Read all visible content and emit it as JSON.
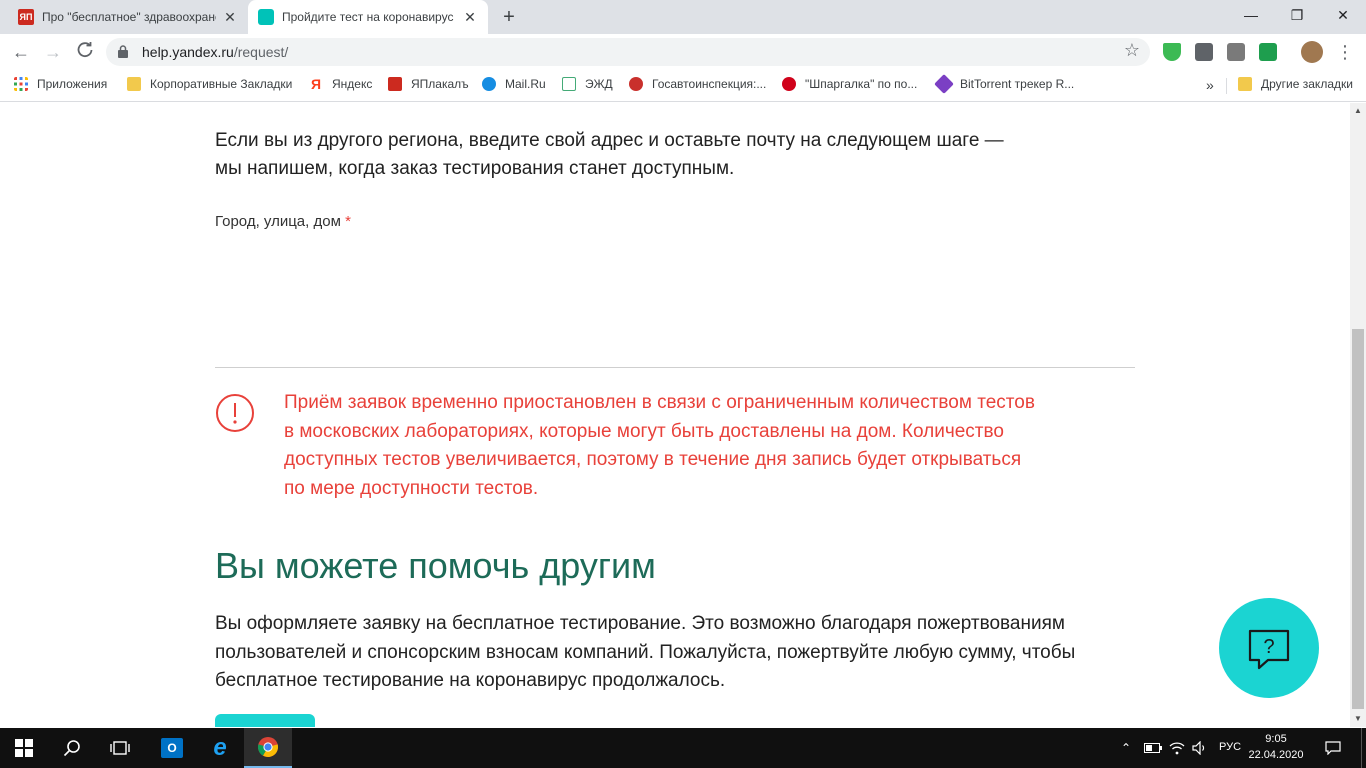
{
  "tabs": [
    {
      "title": "Про \"бесплатное\" здравоохранение",
      "favicon": "yaplakal-favicon",
      "active": false
    },
    {
      "title": "Пройдите тест на коронавирус",
      "favicon": "yandex-help-favicon",
      "active": true
    }
  ],
  "toolbar": {
    "url_host": "help.yandex.ru",
    "url_path": "/request/"
  },
  "bookmarks": {
    "items": [
      {
        "label": "Приложения",
        "icon": "apps-grid-icon"
      },
      {
        "label": "Корпоративные Закладки",
        "icon": "bookmark-folder-icon"
      },
      {
        "label": "Яндекс",
        "icon": "yandex-icon"
      },
      {
        "label": "ЯПлакалъ",
        "icon": "yaplakal-icon"
      },
      {
        "label": "Mail.Ru",
        "icon": "mailru-icon"
      },
      {
        "label": "ЭЖД",
        "icon": "ezhd-icon"
      },
      {
        "label": "Госавтоинспекция:...",
        "icon": "gibdd-icon"
      },
      {
        "label": "\"Шпаргалка\" по по...",
        "icon": "shpargalka-icon"
      },
      {
        "label": "BitTorrent трекер R...",
        "icon": "bittorrent-icon"
      }
    ],
    "overflow": "»",
    "other": "Другие закладки"
  },
  "page": {
    "intro_line1": "Если вы из другого региона, введите свой адрес и оставьте почту на следующем шаге —",
    "intro_line2": "мы напишем, когда заказ тестирования станет доступным.",
    "address_label": "Город, улица, дом",
    "required_mark": "*",
    "alert_lines": [
      "Приём заявок временно приостановлен в связи с ограниченным количеством тестов",
      "в московских лабораториях, которые могут быть доставлены на дом. Количество",
      "доступных тестов увеличивается, поэтому в течение дня запись будет открываться",
      "по мере доступности тестов."
    ],
    "help_title": "Вы можете помочь другим",
    "help_lines": [
      "Вы оформляете заявку на бесплатное тестирование. Это возможно благодаря пожертвованиям",
      "пользователей и спонсорским взносам компаний. Пожалуйста, пожертвуйте любую сумму, чтобы",
      "бесплатное тестирование на коронавирус продолжалось."
    ]
  },
  "taskbar": {
    "language": "РУС",
    "time": "9:05",
    "date": "22.04.2020"
  },
  "colors": {
    "accent_turquoise": "#1bd4d2",
    "alert_red": "#e8413a",
    "heading_green": "#1d6b58"
  }
}
